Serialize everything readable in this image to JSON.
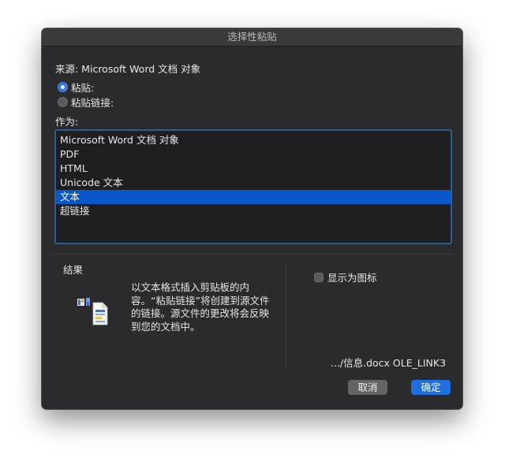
{
  "dialog": {
    "title": "选择性粘贴",
    "source": "来源: Microsoft Word 文档 对象",
    "options": {
      "paste_label": "粘贴:",
      "paste_link_label": "粘贴链接:",
      "selected": "paste"
    },
    "as_label": "作为:",
    "formats": [
      "Microsoft Word 文档 对象",
      "PDF",
      "HTML",
      "Unicode 文本",
      "文本",
      "超链接"
    ],
    "selected_format_index": 4,
    "result": {
      "label": "结果",
      "description": "以文本格式插入剪贴板的内容。“粘贴链接”将创建到源文件的链接。源文件的更改将会反映到您的文档中。"
    },
    "display_as_icon_label": "显示为图标",
    "display_as_icon_checked": false,
    "link_path": ".../信息.docx OLE_LINK3",
    "buttons": {
      "cancel": "取消",
      "ok": "确定"
    },
    "colors": {
      "selection": "#0a57c9",
      "accent_button": "#1f6fde",
      "list_border": "#2e5f93"
    }
  }
}
